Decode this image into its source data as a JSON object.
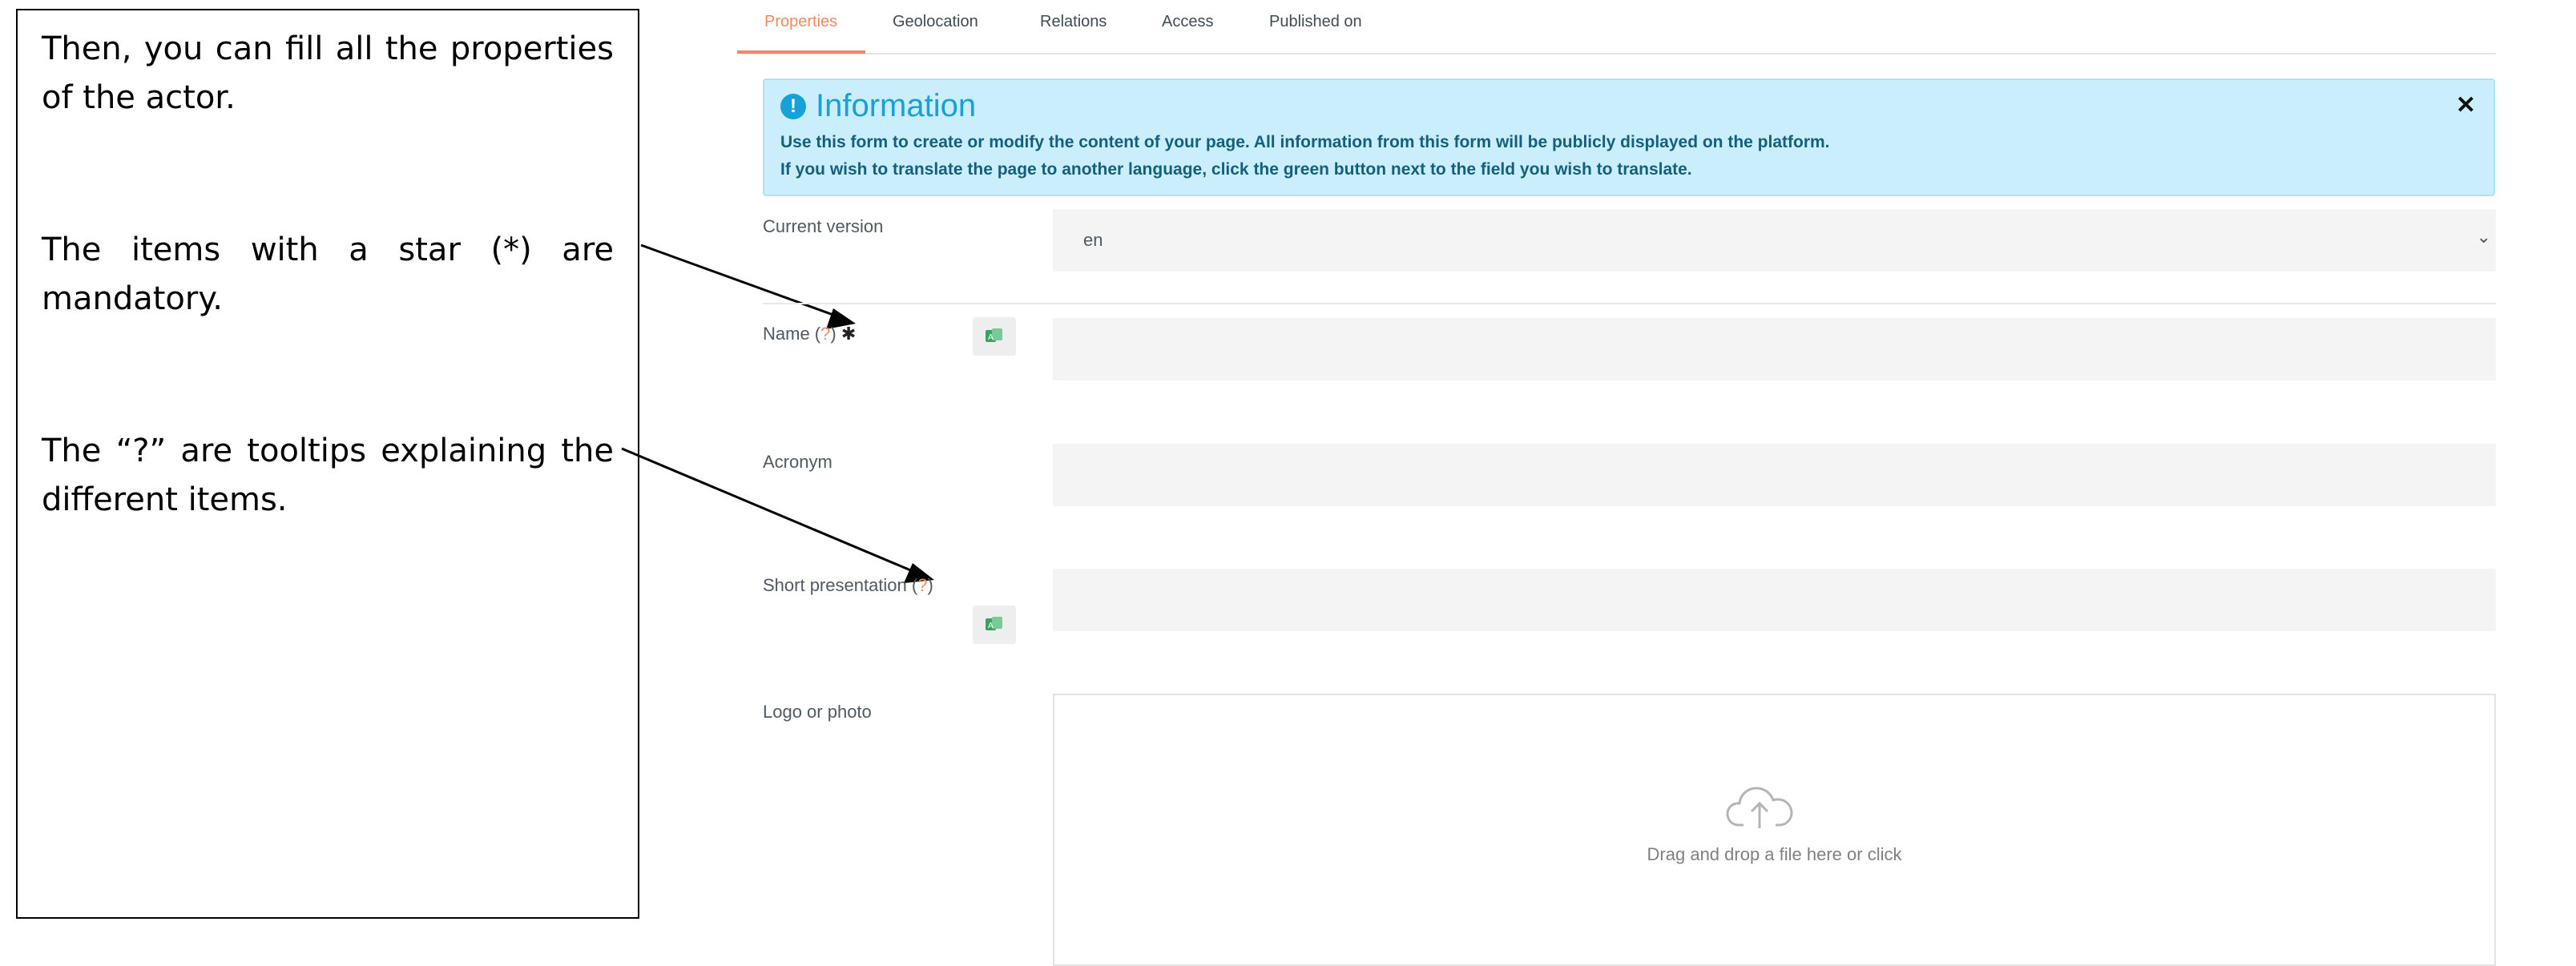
{
  "note": {
    "paragraphs": [
      "Then, you can fill all the properties of the actor.",
      "The items with a star (*) are mandatory.",
      "The “?” are tooltips explaining the different items."
    ]
  },
  "tabs": [
    {
      "label": "Properties",
      "active": true
    },
    {
      "label": "Geolocation",
      "active": false
    },
    {
      "label": "Relations",
      "active": false
    },
    {
      "label": "Access",
      "active": false
    },
    {
      "label": "Published on",
      "active": false
    }
  ],
  "info": {
    "icon": "exclamation-icon",
    "title": "Information",
    "close_icon": "close-icon",
    "line1": "Use this form to create or modify the content of your page. All information from this form will be publicly displayed on the platform.",
    "line2": "If you wish to translate the page to another language, click the green button next to the field you wish to translate."
  },
  "fields": {
    "current_version": {
      "label": "Current version",
      "value": "en",
      "icon": "chevron-down-icon"
    },
    "name": {
      "label": "Name (",
      "tooltip": "?",
      "close": ")",
      "required": "✱",
      "value": ""
    },
    "acronym": {
      "label": "Acronym",
      "value": ""
    },
    "short_presentation": {
      "label": "Short presentation (",
      "tooltip": "?",
      "close": ")",
      "value": ""
    },
    "logo": {
      "label": "Logo or photo",
      "dropzone_text": "Drag and drop a file here or click",
      "icon": "cloud-upload-icon"
    }
  },
  "translate_button": {
    "icon": "translate-icon"
  },
  "colors": {
    "accent": "#f08a63",
    "info_bg": "#caeefb",
    "info_title": "#16a1d8",
    "info_text": "#135f7e",
    "translate_green": "#3aa35c"
  }
}
